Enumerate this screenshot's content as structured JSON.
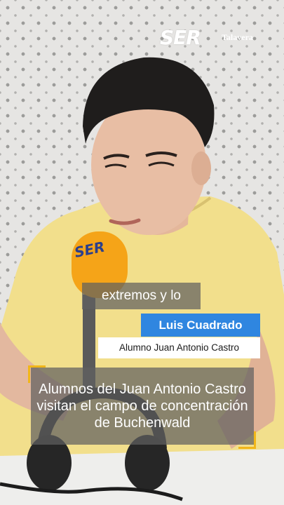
{
  "brand": {
    "logo_text": "SER",
    "station": "Talavera"
  },
  "captions": {
    "subtitle": "extremos y lo",
    "speaker_name": "Luis Cuadrado",
    "speaker_role": "Alumno Juan Antonio Castro",
    "headline": "Alumnos del Juan Antonio Castro visitan el campo de concentración de Buchenwald"
  },
  "colors": {
    "name_box": "#2f86e0",
    "accent_corners": "#f1b619",
    "microphone": "#f5a418",
    "shirt": "#f3e08e"
  },
  "icons": {
    "mic_logo": "SER"
  }
}
